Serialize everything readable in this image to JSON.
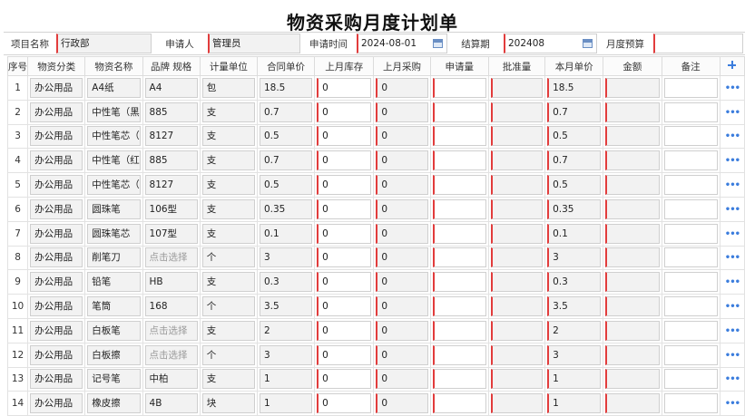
{
  "title": "物资采购月度计划单",
  "form": {
    "project_label": "项目名称",
    "project_value": "行政部",
    "applicant_label": "申请人",
    "applicant_value": "管理员",
    "apply_time_label": "申请时间",
    "apply_time_value": "2024-08-01",
    "period_label": "结算期",
    "period_value": "202408",
    "budget_label": "月度预算",
    "budget_value": ""
  },
  "columns": [
    "序号",
    "物资分类",
    "物资名称",
    "品牌 规格",
    "计量单位",
    "合同单价",
    "上月库存",
    "上月采购",
    "申请量",
    "批准量",
    "本月单价",
    "金额",
    "备注"
  ],
  "select_placeholder": "点击选择",
  "rows": [
    {
      "no": "1",
      "cat": "办公用品",
      "name": "A4纸",
      "spec": "A4",
      "unit": "包",
      "price": "18.5",
      "stock": "0",
      "purchase": "0",
      "apply": "",
      "approve": "",
      "month_price": "18.5",
      "amount": "",
      "note": ""
    },
    {
      "no": "2",
      "cat": "办公用品",
      "name": "中性笔（黑）",
      "spec": "885",
      "unit": "支",
      "price": "0.7",
      "stock": "0",
      "purchase": "0",
      "apply": "",
      "approve": "",
      "month_price": "0.7",
      "amount": "",
      "note": ""
    },
    {
      "no": "3",
      "cat": "办公用品",
      "name": "中性笔芯（黑）",
      "spec": "8127",
      "unit": "支",
      "price": "0.5",
      "stock": "0",
      "purchase": "0",
      "apply": "",
      "approve": "",
      "month_price": "0.5",
      "amount": "",
      "note": ""
    },
    {
      "no": "4",
      "cat": "办公用品",
      "name": "中性笔（红）",
      "spec": "885",
      "unit": "支",
      "price": "0.7",
      "stock": "0",
      "purchase": "0",
      "apply": "",
      "approve": "",
      "month_price": "0.7",
      "amount": "",
      "note": ""
    },
    {
      "no": "5",
      "cat": "办公用品",
      "name": "中性笔芯（红）",
      "spec": "8127",
      "unit": "支",
      "price": "0.5",
      "stock": "0",
      "purchase": "0",
      "apply": "",
      "approve": "",
      "month_price": "0.5",
      "amount": "",
      "note": ""
    },
    {
      "no": "6",
      "cat": "办公用品",
      "name": "圆珠笔",
      "spec": "106型",
      "unit": "支",
      "price": "0.35",
      "stock": "0",
      "purchase": "0",
      "apply": "",
      "approve": "",
      "month_price": "0.35",
      "amount": "",
      "note": ""
    },
    {
      "no": "7",
      "cat": "办公用品",
      "name": "圆珠笔芯",
      "spec": "107型",
      "unit": "支",
      "price": "0.1",
      "stock": "0",
      "purchase": "0",
      "apply": "",
      "approve": "",
      "month_price": "0.1",
      "amount": "",
      "note": ""
    },
    {
      "no": "8",
      "cat": "办公用品",
      "name": "削笔刀",
      "spec": "",
      "unit": "个",
      "price": "3",
      "stock": "0",
      "purchase": "0",
      "apply": "",
      "approve": "",
      "month_price": "3",
      "amount": "",
      "note": ""
    },
    {
      "no": "9",
      "cat": "办公用品",
      "name": "铅笔",
      "spec": "HB",
      "unit": "支",
      "price": "0.3",
      "stock": "0",
      "purchase": "0",
      "apply": "",
      "approve": "",
      "month_price": "0.3",
      "amount": "",
      "note": ""
    },
    {
      "no": "10",
      "cat": "办公用品",
      "name": "笔筒",
      "spec": "168",
      "unit": "个",
      "price": "3.5",
      "stock": "0",
      "purchase": "0",
      "apply": "",
      "approve": "",
      "month_price": "3.5",
      "amount": "",
      "note": ""
    },
    {
      "no": "11",
      "cat": "办公用品",
      "name": "白板笔",
      "spec": "",
      "unit": "支",
      "price": "2",
      "stock": "0",
      "purchase": "0",
      "apply": "",
      "approve": "",
      "month_price": "2",
      "amount": "",
      "note": ""
    },
    {
      "no": "12",
      "cat": "办公用品",
      "name": "白板擦",
      "spec": "",
      "unit": "个",
      "price": "3",
      "stock": "0",
      "purchase": "0",
      "apply": "",
      "approve": "",
      "month_price": "3",
      "amount": "",
      "note": ""
    },
    {
      "no": "13",
      "cat": "办公用品",
      "name": "记号笔",
      "spec": "中柏",
      "unit": "支",
      "price": "1",
      "stock": "0",
      "purchase": "0",
      "apply": "",
      "approve": "",
      "month_price": "1",
      "amount": "",
      "note": ""
    },
    {
      "no": "14",
      "cat": "办公用品",
      "name": "橡皮擦",
      "spec": "4B",
      "unit": "块",
      "price": "1",
      "stock": "0",
      "purchase": "0",
      "apply": "",
      "approve": "",
      "month_price": "1",
      "amount": "",
      "note": ""
    }
  ],
  "icons": {
    "add": "plus-icon",
    "row_menu": "more-dots-icon"
  },
  "colors": {
    "required_marker": "#e23c3c",
    "link_blue": "#3b7ddd"
  }
}
